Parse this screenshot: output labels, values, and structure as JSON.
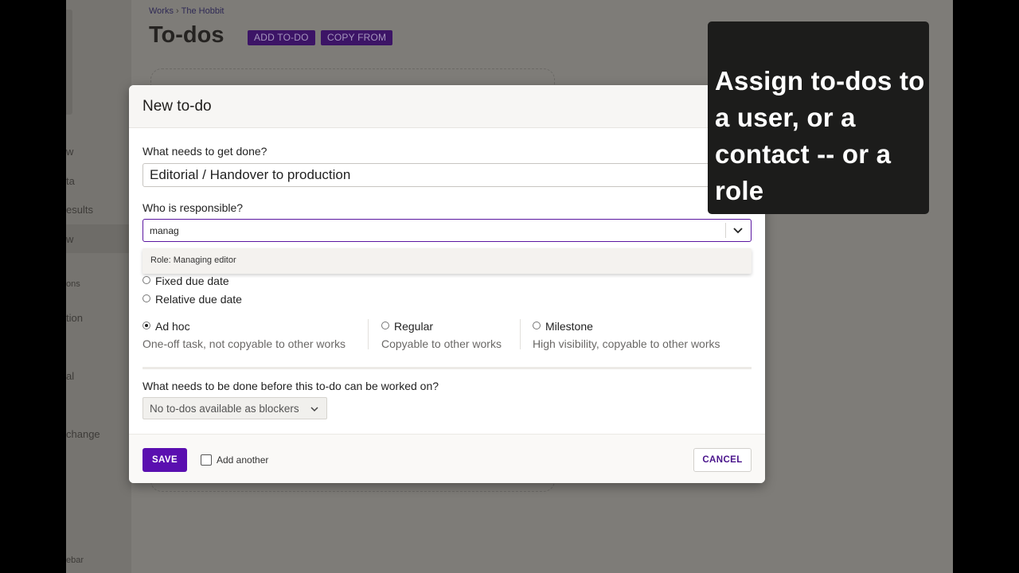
{
  "sidebar": {
    "items": [
      "w",
      "ta",
      "esults",
      "w",
      "ons",
      "tion",
      "al",
      "change",
      "ebar"
    ]
  },
  "breadcrumb": {
    "items": [
      "Works",
      "The Hobbit"
    ],
    "separator": "›"
  },
  "page": {
    "title": "To-dos",
    "add_button": "ADD TO-DO",
    "copy_button": "COPY FROM"
  },
  "modal": {
    "title": "New to-do",
    "task_label": "What needs to get done?",
    "task_value": "Editorial / Handover to production",
    "responsible_label": "Who is responsible?",
    "responsible_value": "manag",
    "dropdown_option": "Role: Managing editor",
    "due": {
      "fixed": "Fixed due date",
      "relative": "Relative due date"
    },
    "types": [
      {
        "label": "Ad hoc",
        "desc": "One-off task, not copyable to other works",
        "selected": true
      },
      {
        "label": "Regular",
        "desc": "Copyable to other works",
        "selected": false
      },
      {
        "label": "Milestone",
        "desc": "High visibility, copyable to other works",
        "selected": false
      }
    ],
    "blockers_label": "What needs to be done before this to-do can be worked on?",
    "blockers_value": "No to-dos available as blockers",
    "save_label": "SAVE",
    "add_another_label": "Add another",
    "cancel_label": "CANCEL"
  },
  "callout": {
    "text": "Assign to-dos to a user, or a contact -- or a role"
  },
  "colors": {
    "accent": "#5a0fb0",
    "header_button": "#3c1466",
    "callout_bg": "#1c1c1b"
  }
}
